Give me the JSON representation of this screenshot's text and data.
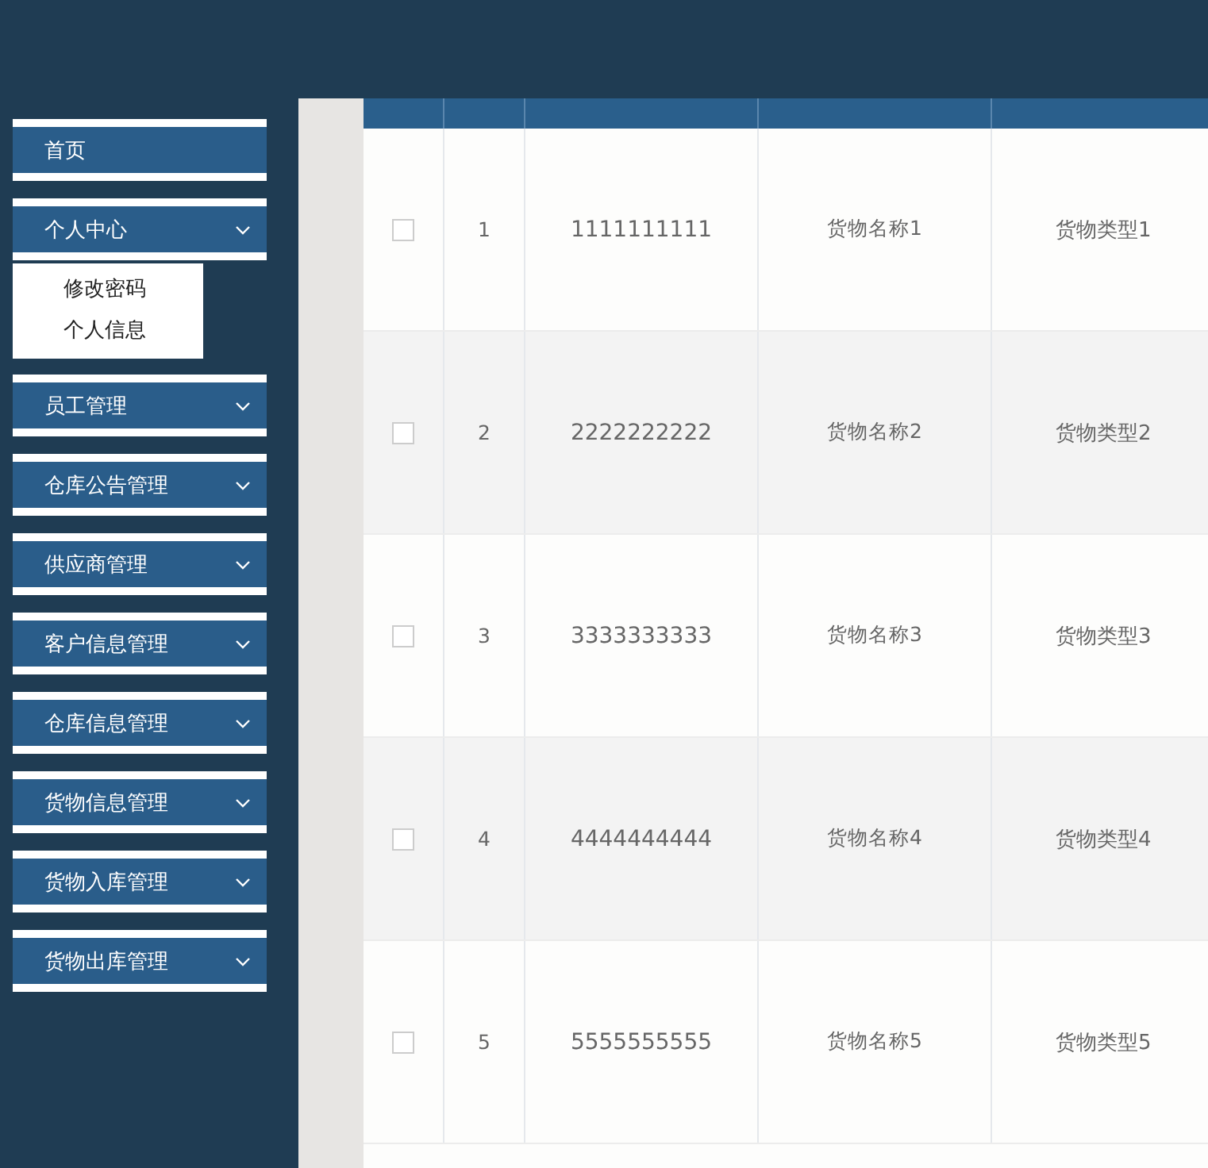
{
  "sidebar": {
    "items": [
      {
        "label": "首页",
        "kind": "link"
      },
      {
        "label": "个人中心",
        "kind": "menu",
        "children": [
          {
            "label": "修改密码"
          },
          {
            "label": "个人信息"
          }
        ]
      },
      {
        "label": "员工管理",
        "kind": "menu"
      },
      {
        "label": "仓库公告管理",
        "kind": "menu"
      },
      {
        "label": "供应商管理",
        "kind": "menu"
      },
      {
        "label": "客户信息管理",
        "kind": "menu"
      },
      {
        "label": "仓库信息管理",
        "kind": "menu"
      },
      {
        "label": "货物信息管理",
        "kind": "menu"
      },
      {
        "label": "货物入库管理",
        "kind": "menu"
      },
      {
        "label": "货物出库管理",
        "kind": "menu"
      }
    ]
  },
  "table": {
    "rows": [
      {
        "checked": false,
        "index": "1",
        "column_3": "1111111111",
        "column_4": "货物名称1",
        "column_5": "货物类型1"
      },
      {
        "checked": false,
        "index": "2",
        "column_3": "2222222222",
        "column_4": "货物名称2",
        "column_5": "货物类型2"
      },
      {
        "checked": false,
        "index": "3",
        "column_3": "3333333333",
        "column_4": "货物名称3",
        "column_5": "货物类型3"
      },
      {
        "checked": false,
        "index": "4",
        "column_3": "4444444444",
        "column_4": "货物名称4",
        "column_5": "货物类型4"
      },
      {
        "checked": false,
        "index": "5",
        "column_3": "5555555555",
        "column_4": "货物名称5",
        "column_5": "货物类型5"
      }
    ]
  }
}
